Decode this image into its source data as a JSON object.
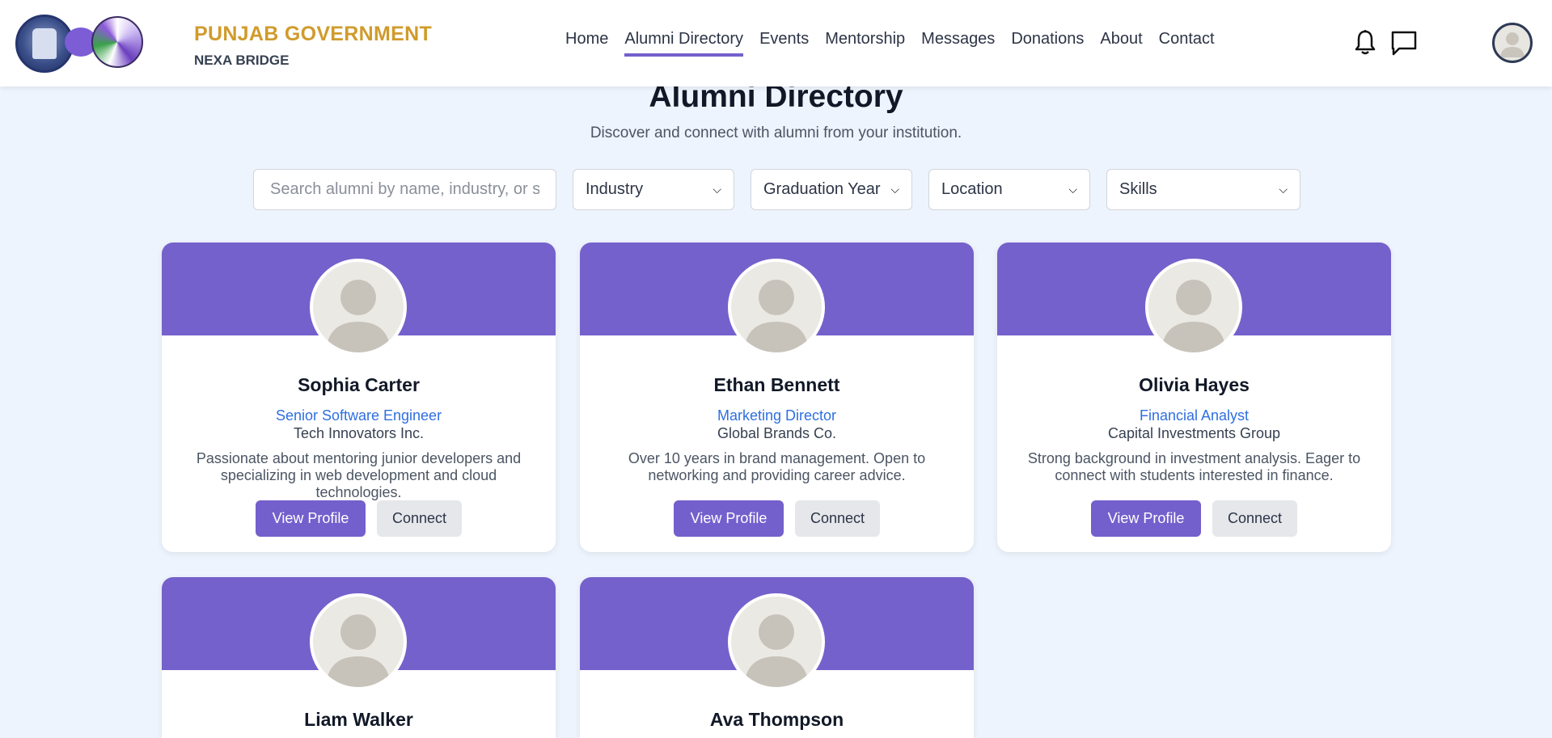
{
  "header": {
    "brand_title": "PUNJAB GOVERNMENT",
    "brand_subtitle": "NEXA BRIDGE",
    "nav": [
      "Home",
      "Alumni Directory",
      "Events",
      "Mentorship",
      "Messages",
      "Donations",
      "About",
      "Contact"
    ],
    "active_nav": "Alumni Directory",
    "icons": [
      "bell-icon",
      "chat-icon",
      "avatar-icon"
    ]
  },
  "main": {
    "title": "Alumni Directory",
    "subtitle": "Discover and connect with alumni from your institution."
  },
  "filters": {
    "search_placeholder": "Search alumni by name, industry, or skills",
    "industry": "Industry",
    "graduation_year": "Graduation Year",
    "location": "Location",
    "skills": "Skills"
  },
  "cards": [
    {
      "name": "Sophia Carter",
      "role": "Senior Software Engineer",
      "company": "Tech Innovators Inc.",
      "bio": "Passionate about mentoring junior developers and specializing in web development and cloud technologies.",
      "view_label": "View Profile",
      "connect_label": "Connect"
    },
    {
      "name": "Ethan Bennett",
      "role": "Marketing Director",
      "company": "Global Brands Co.",
      "bio": "Over 10 years in brand management. Open to networking and providing career advice.",
      "view_label": "View Profile",
      "connect_label": "Connect"
    },
    {
      "name": "Olivia Hayes",
      "role": "Financial Analyst",
      "company": "Capital Investments Group",
      "bio": "Strong background in investment analysis. Eager to connect with students interested in finance.",
      "view_label": "View Profile",
      "connect_label": "Connect"
    },
    {
      "name": "Liam Walker"
    },
    {
      "name": "Ava Thompson"
    }
  ],
  "colors": {
    "accent": "#7360cc",
    "brand_gold": "#d09b2c",
    "link_blue": "#2f6fe0",
    "page_bg": "#eef4fd"
  }
}
